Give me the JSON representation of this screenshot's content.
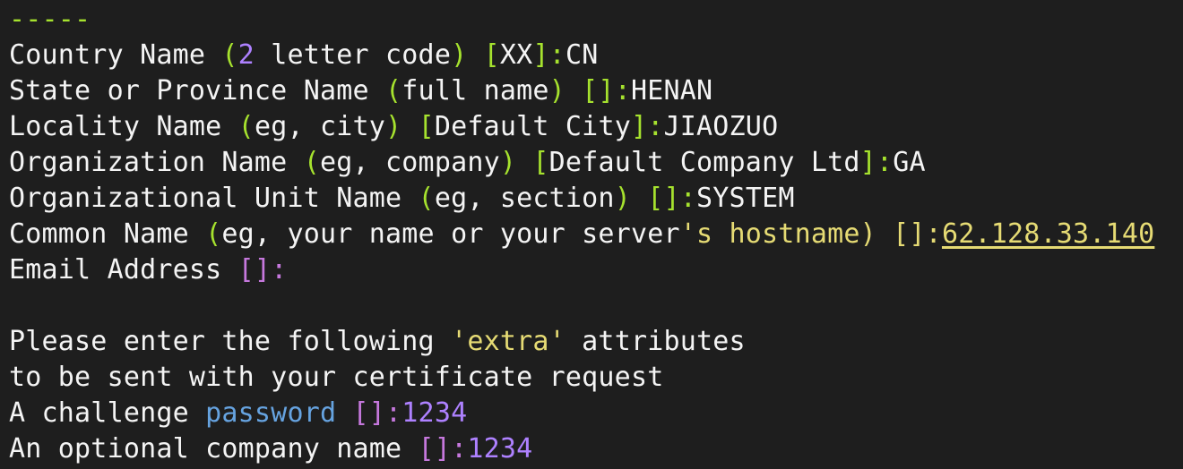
{
  "terminal": {
    "lines": [
      [
        {
          "t": "-----",
          "c": "green"
        }
      ],
      [
        {
          "t": "Country Name ",
          "c": "plain"
        },
        {
          "t": "(",
          "c": "green"
        },
        {
          "t": "2",
          "c": "purple"
        },
        {
          "t": " letter code",
          "c": "plain"
        },
        {
          "t": ")",
          "c": "green"
        },
        {
          "t": " ",
          "c": "plain"
        },
        {
          "t": "[",
          "c": "green"
        },
        {
          "t": "XX",
          "c": "plain"
        },
        {
          "t": "]:",
          "c": "green"
        },
        {
          "t": "CN",
          "c": "plain"
        }
      ],
      [
        {
          "t": "State or Province Name ",
          "c": "plain"
        },
        {
          "t": "(",
          "c": "green"
        },
        {
          "t": "full name",
          "c": "plain"
        },
        {
          "t": ")",
          "c": "green"
        },
        {
          "t": " ",
          "c": "plain"
        },
        {
          "t": "[]:",
          "c": "green"
        },
        {
          "t": "HENAN",
          "c": "plain"
        }
      ],
      [
        {
          "t": "Locality Name ",
          "c": "plain"
        },
        {
          "t": "(",
          "c": "green"
        },
        {
          "t": "eg, city",
          "c": "plain"
        },
        {
          "t": ")",
          "c": "green"
        },
        {
          "t": " ",
          "c": "plain"
        },
        {
          "t": "[",
          "c": "green"
        },
        {
          "t": "Default City",
          "c": "plain"
        },
        {
          "t": "]:",
          "c": "green"
        },
        {
          "t": "JIAOZUO",
          "c": "plain"
        }
      ],
      [
        {
          "t": "Organization Name ",
          "c": "plain"
        },
        {
          "t": "(",
          "c": "green"
        },
        {
          "t": "eg, company",
          "c": "plain"
        },
        {
          "t": ")",
          "c": "green"
        },
        {
          "t": " ",
          "c": "plain"
        },
        {
          "t": "[",
          "c": "green"
        },
        {
          "t": "Default Company Ltd",
          "c": "plain"
        },
        {
          "t": "]:",
          "c": "green"
        },
        {
          "t": "GA",
          "c": "plain"
        }
      ],
      [
        {
          "t": "Organizational Unit Name ",
          "c": "plain"
        },
        {
          "t": "(",
          "c": "green"
        },
        {
          "t": "eg, section",
          "c": "plain"
        },
        {
          "t": ")",
          "c": "green"
        },
        {
          "t": " ",
          "c": "plain"
        },
        {
          "t": "[]:",
          "c": "green"
        },
        {
          "t": "SYSTEM",
          "c": "plain"
        }
      ],
      [
        {
          "t": "Common Name ",
          "c": "plain"
        },
        {
          "t": "(",
          "c": "green"
        },
        {
          "t": "eg, your name or your server",
          "c": "plain"
        },
        {
          "t": "'s hostname",
          "c": "yellow"
        },
        {
          "t": ")",
          "c": "yellow"
        },
        {
          "t": " ",
          "c": "plain"
        },
        {
          "t": "[]:",
          "c": "yellow"
        },
        {
          "t": "62.128.33.140",
          "c": "yellow",
          "u": true
        }
      ],
      [
        {
          "t": "Email Address ",
          "c": "plain"
        },
        {
          "t": "[]:",
          "c": "magenta"
        }
      ],
      [],
      [
        {
          "t": "Please enter the following ",
          "c": "plain"
        },
        {
          "t": "'extra'",
          "c": "yellow"
        },
        {
          "t": " attributes",
          "c": "plain"
        }
      ],
      [
        {
          "t": "to be sent with your certificate request",
          "c": "plain"
        }
      ],
      [
        {
          "t": "A challenge ",
          "c": "plain"
        },
        {
          "t": "password",
          "c": "blue"
        },
        {
          "t": " ",
          "c": "plain"
        },
        {
          "t": "[]:",
          "c": "magenta"
        },
        {
          "t": "1234",
          "c": "purple"
        }
      ],
      [
        {
          "t": "An optional company name ",
          "c": "plain"
        },
        {
          "t": "[]:",
          "c": "magenta"
        },
        {
          "t": "1234",
          "c": "purple"
        }
      ]
    ]
  },
  "colors": {
    "background": "#1e1e1e",
    "plain": "#f4f4f4",
    "green": "#a6e22e",
    "purple": "#ae81ff",
    "yellow": "#e6db74",
    "blue": "#66a3e0",
    "magenta": "#c678dd"
  }
}
